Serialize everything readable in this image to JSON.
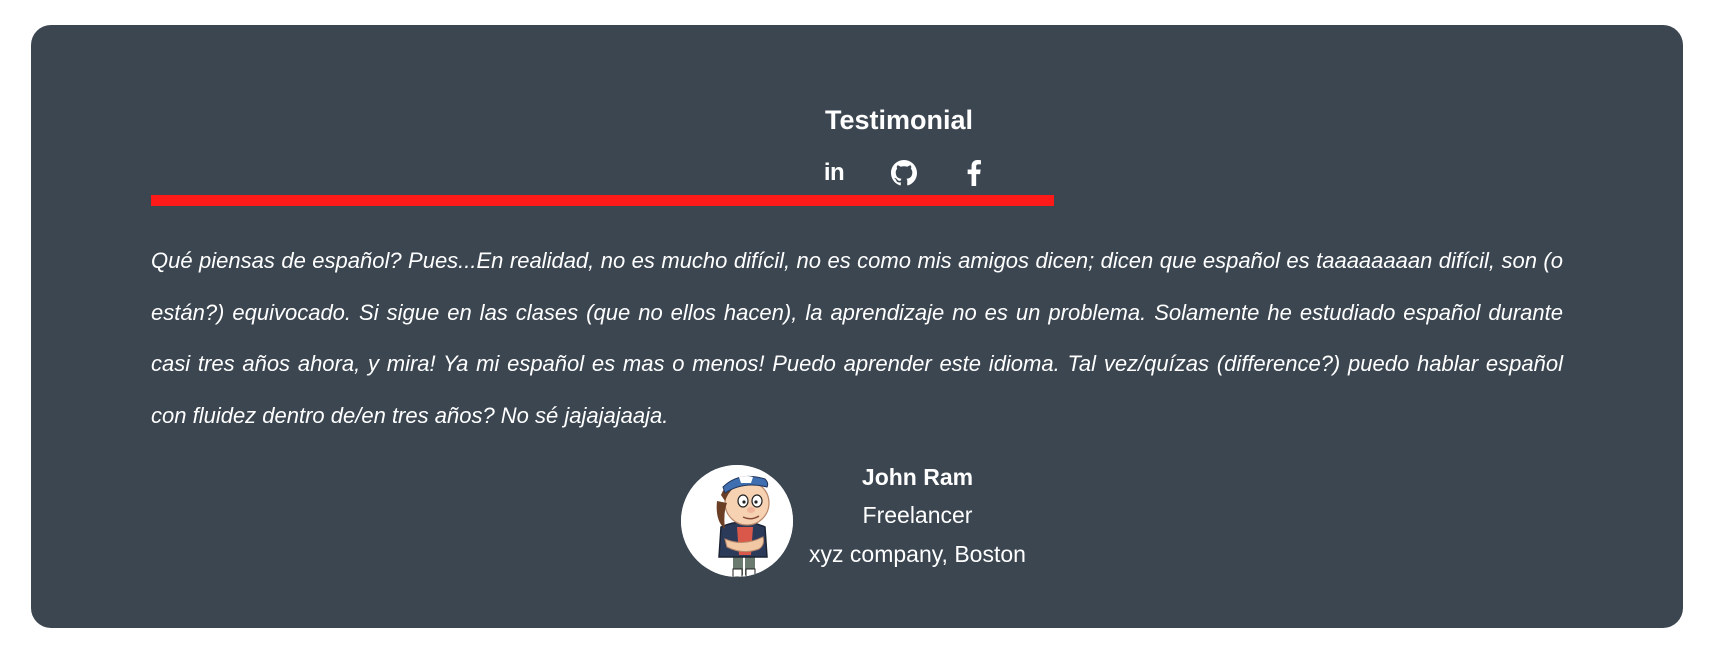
{
  "testimonial": {
    "title": "Testimonial",
    "social": [
      {
        "name": "linkedin",
        "icon": "linkedin-icon",
        "label": "in"
      },
      {
        "name": "github",
        "icon": "github-icon"
      },
      {
        "name": "facebook",
        "icon": "facebook-icon"
      }
    ],
    "quote": "Qué piensas de español? Pues...En realidad, no es mucho difícil, no es como mis amigos dicen; dicen que español es taaaaaaaan difícil, son (o están?) equivocado. Si sigue en las clases (que no ellos hacen), la aprendizaje no es un problema. Solamente he estudiado español durante casi tres años ahora, y mira! Ya mi español es mas o menos! Puedo aprender este idioma. Tal vez/quízas (difference?) puedo hablar español con fluidez dentro de/en tres años? No sé jajajajaaja.",
    "author": {
      "name": "John Ram",
      "role": "Freelancer",
      "company": "xyz company, Boston",
      "avatar_icon": "cartoon-boy-avatar"
    }
  },
  "colors": {
    "card_background": "#3b4651",
    "accent_bar": "#ff1a1a",
    "text": "#ffffff"
  }
}
